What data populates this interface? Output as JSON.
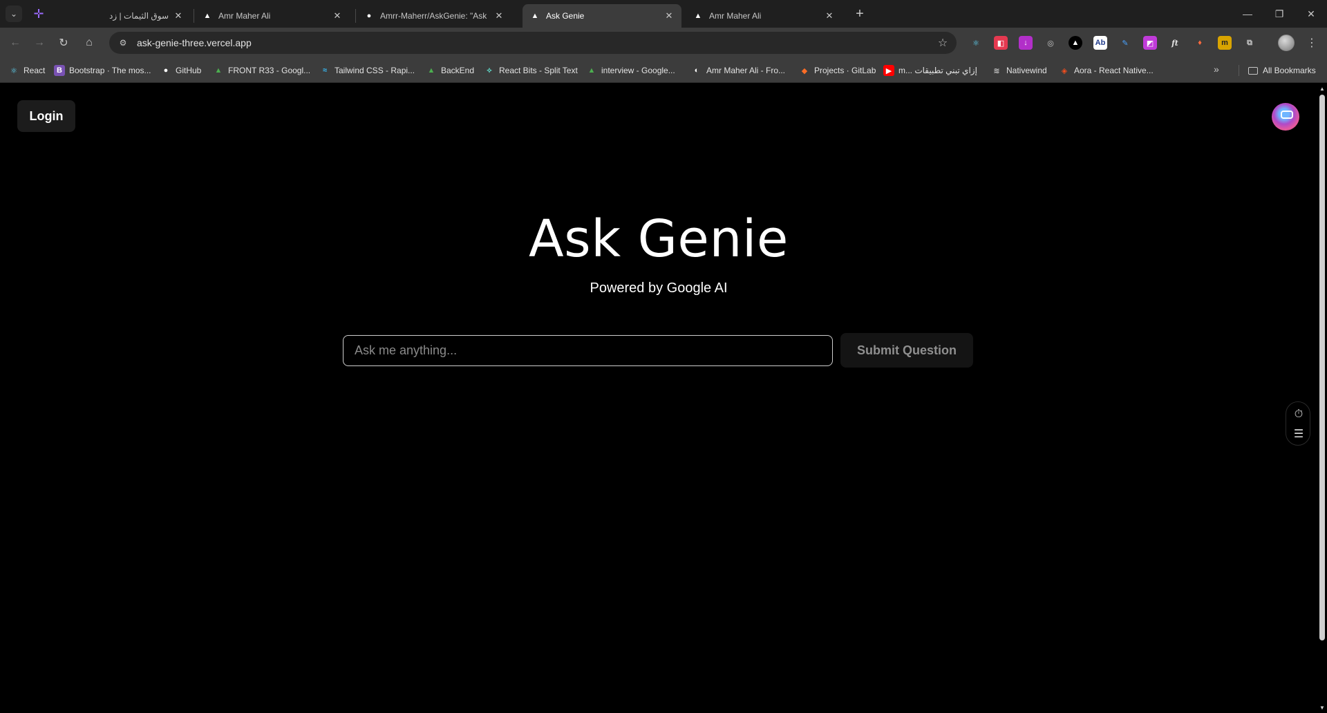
{
  "tabs": [
    {
      "title": "سوق الثيمات | زد",
      "favicon": "plus-icon"
    },
    {
      "title": "Amr Maher Ali",
      "favicon": "triangle-icon"
    },
    {
      "title": "Amrr-Maherr/AskGenie: \"Ask G",
      "favicon": "github-icon"
    },
    {
      "title": "Ask Genie",
      "favicon": "triangle-icon",
      "active": true
    },
    {
      "title": "Amr Maher Ali",
      "favicon": "triangle-icon"
    }
  ],
  "address_bar": {
    "url": "ask-genie-three.vercel.app"
  },
  "bookmarks": [
    {
      "label": "React"
    },
    {
      "label": "Bootstrap · The mos..."
    },
    {
      "label": "GitHub"
    },
    {
      "label": "FRONT R33 - Googl..."
    },
    {
      "label": "Tailwind CSS - Rapi..."
    },
    {
      "label": "BackEnd"
    },
    {
      "label": "React Bits - Split Text"
    },
    {
      "label": "interview - Google..."
    },
    {
      "label": "Amr Maher Ali - Fro..."
    },
    {
      "label": "Projects · GitLab"
    },
    {
      "label": "m... إزاي تبني تطبيقات"
    },
    {
      "label": "Nativewind"
    },
    {
      "label": "Aora - React Native..."
    }
  ],
  "bookmarks_all": "All Bookmarks",
  "page": {
    "login_label": "Login",
    "title": "Ask Genie",
    "subtitle": "Powered by Google AI",
    "input_placeholder": "Ask me anything...",
    "submit_label": "Submit Question"
  },
  "colors": {
    "page_background": "#000000",
    "chrome_background": "#3c3c3c",
    "tabstrip_background": "#1f1f1f",
    "input_border": "#cfcfcf",
    "submit_text": "#8f8f8f"
  }
}
